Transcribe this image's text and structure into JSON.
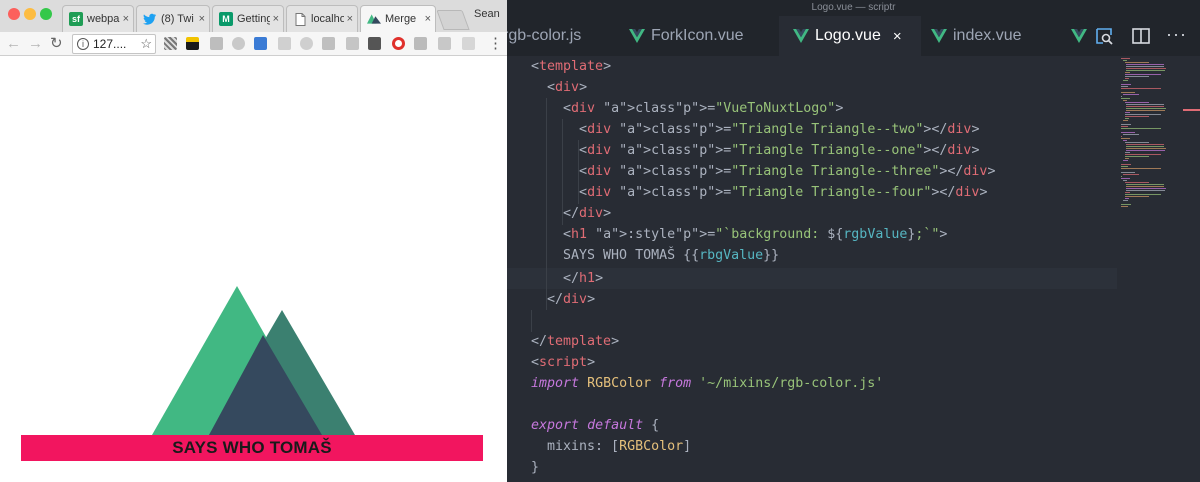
{
  "browser": {
    "tabs": [
      {
        "label": "webpa",
        "close": "×"
      },
      {
        "label": "(8) Twi",
        "close": "×"
      },
      {
        "label": "Getting",
        "close": "×"
      },
      {
        "label": "localho",
        "close": "×"
      },
      {
        "label": "Merge",
        "close": "×"
      }
    ],
    "tab_badges": {
      "sf": "sf",
      "vue": "M"
    },
    "profile": "Sean",
    "nav": {
      "back": "←",
      "forward": "→",
      "reload": "↻",
      "menu": "⋮"
    },
    "omnibox": {
      "info": "i",
      "url": "127....",
      "star": "☆"
    },
    "page": {
      "heading": "SAYS WHO TOMAŠ",
      "colors": {
        "triangle_back": "#41b883",
        "triangle_right": "#3b8070",
        "triangle_front": "#35495e",
        "banner": "#f2155f"
      }
    }
  },
  "editor": {
    "window_title": "Logo.vue — scriptr",
    "tabs": [
      {
        "label": "rgb-color.js",
        "active": false
      },
      {
        "label": "ForkIcon.vue",
        "active": false
      },
      {
        "label": "Logo.vue",
        "active": true,
        "close": "×"
      },
      {
        "label": "index.vue",
        "active": false
      }
    ],
    "code_lines": [
      "<template>",
      "  <div>",
      "    <div class=\"VueToNuxtLogo\">",
      "      <div class=\"Triangle Triangle--two\"></div>",
      "      <div class=\"Triangle Triangle--one\"></div>",
      "      <div class=\"Triangle Triangle--three\"></div>",
      "      <div class=\"Triangle Triangle--four\"></div>",
      "    </div>",
      "    <h1 :style=\"`background: ${rgbValue};`\">",
      "    SAYS WHO TOMAŠ {{rbgValue}}",
      "    </h1>",
      "  </div>",
      "",
      "</template>",
      "<script>",
      "import RGBColor from '~/mixins/rgb-color.js'",
      "",
      "export default {",
      "  mixins: [RGBColor]",
      "}"
    ],
    "colors": {
      "background": "#282c34",
      "tag": "#e06c75",
      "attr": "#d19a66",
      "string": "#98c379",
      "keyword": "#c678dd",
      "vue_green": "#41b883"
    }
  }
}
